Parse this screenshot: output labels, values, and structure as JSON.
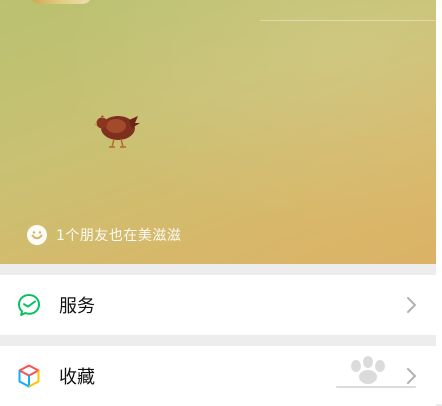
{
  "cover": {
    "friend_note": "1个朋友也在美滋滋"
  },
  "menu": {
    "items": [
      {
        "label": "服务",
        "icon": "services-icon"
      },
      {
        "label": "收藏",
        "icon": "favorites-cube-icon"
      }
    ]
  },
  "colors": {
    "services_green": "#07c160",
    "chevron": "#b2b2b2",
    "page_background": "#ededed"
  }
}
